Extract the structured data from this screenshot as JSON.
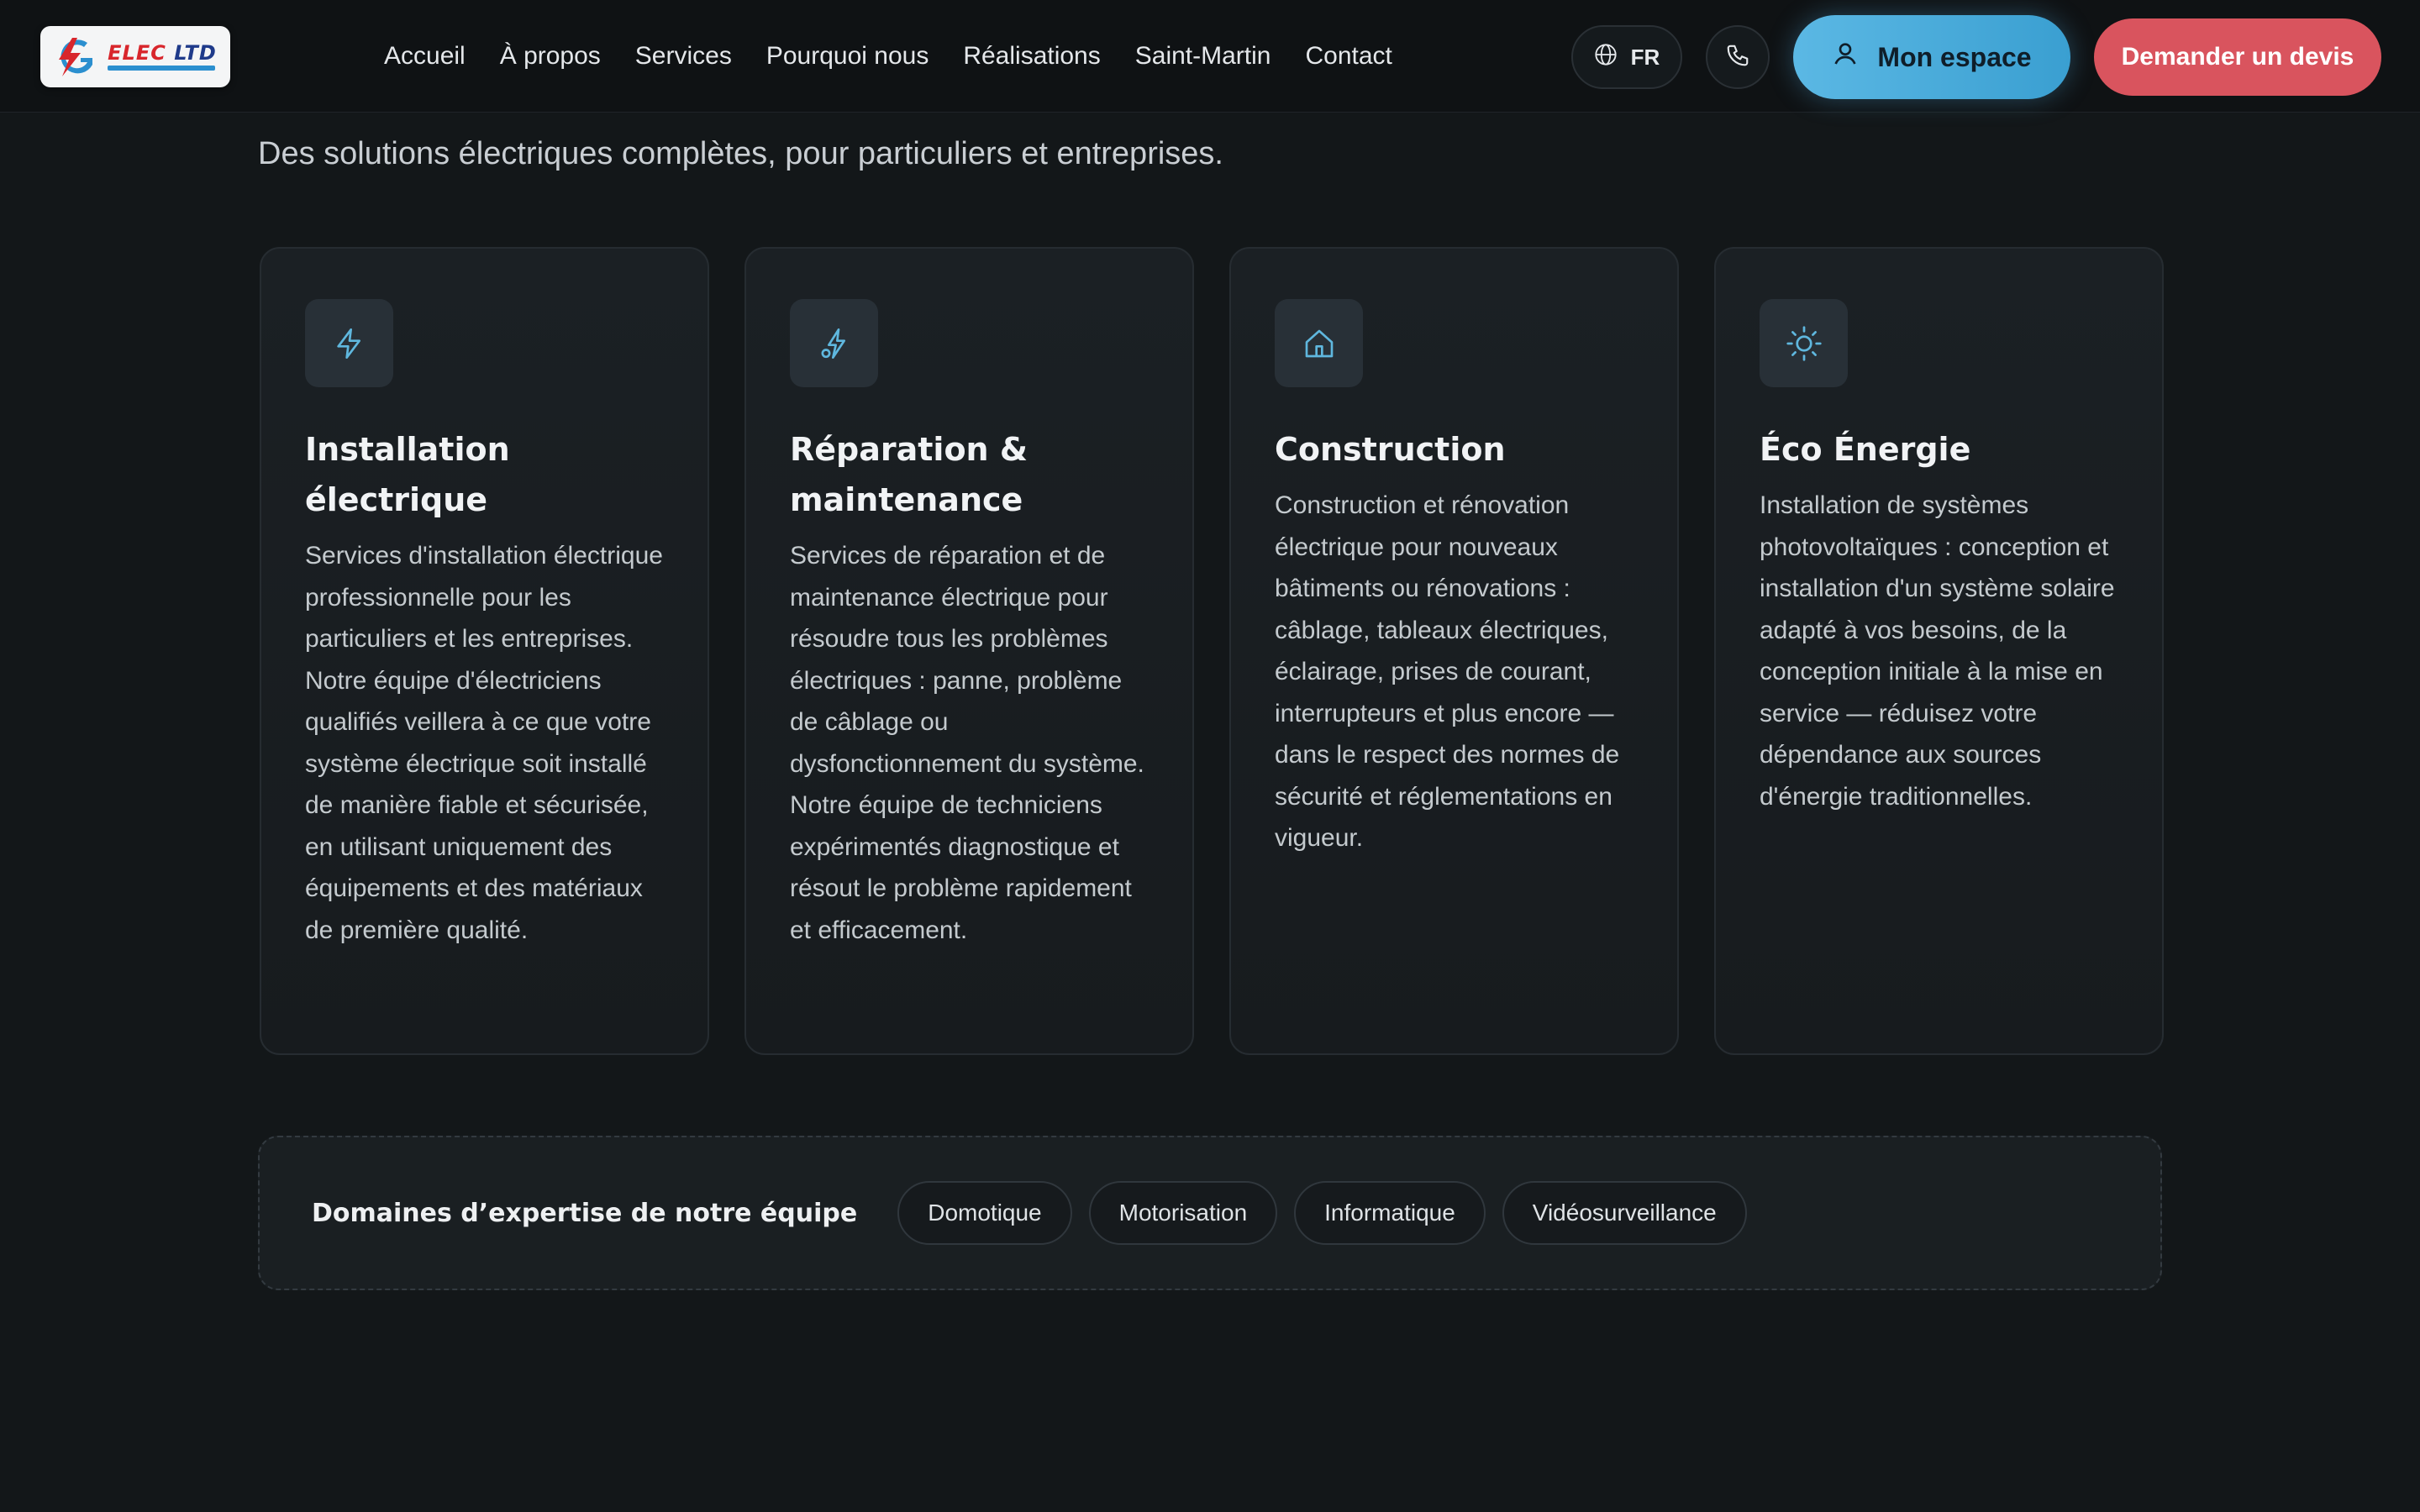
{
  "header": {
    "logo": {
      "word_part1": "ELEC",
      "word_part2": "LTD",
      "brand_red": "#d8262c",
      "brand_blue": "#1e3a8a"
    },
    "nav": [
      {
        "label": "Accueil"
      },
      {
        "label": "À propos"
      },
      {
        "label": "Services"
      },
      {
        "label": "Pourquoi nous"
      },
      {
        "label": "Réalisations"
      },
      {
        "label": "Saint-Martin"
      },
      {
        "label": "Contact"
      }
    ],
    "language": {
      "label": "FR",
      "icon": "globe-icon"
    },
    "phone": {
      "icon": "phone-icon"
    },
    "account_button": {
      "label": "Mon espace",
      "icon": "user-icon",
      "color": "#4aaedb"
    },
    "quote_button": {
      "label": "Demander un devis",
      "color": "#d9545e"
    }
  },
  "main": {
    "subtitle": "Des solutions électriques complètes, pour particuliers et entreprises.",
    "cards": [
      {
        "icon": "lightning-icon",
        "title": "Installation électrique",
        "text": "Services d'installation électrique professionnelle pour les particuliers et les entreprises. Notre équipe d'électriciens qualifiés veillera à ce que votre système électrique soit installé de manière fiable et sécurisée, en utilisant uniquement des équipements et des matériaux de première qualité."
      },
      {
        "icon": "plug-bolt-icon",
        "title": "Réparation & maintenance",
        "text": "Services de réparation et de maintenance électrique pour résoudre tous les problèmes électriques : panne, problème de câblage ou dysfonctionnement du système. Notre équipe de techniciens expérimentés diagnostique et résout le problème rapidement et efficacement."
      },
      {
        "icon": "house-icon",
        "title": "Construction",
        "text": "Construction et rénovation électrique pour nouveaux bâtiments ou rénovations : câblage, tableaux électriques, éclairage, prises de courant, interrupteurs et plus encore — dans le respect des normes de sécurité et réglementations en vigueur."
      },
      {
        "icon": "sun-icon",
        "title": "Éco Énergie",
        "text": "Installation de systèmes photovoltaïques : conception et installation d'un système solaire adapté à vos besoins, de la conception initiale à la mise en service — réduisez votre dépendance aux sources d'énergie traditionnelles."
      }
    ],
    "expertise": {
      "label": "Domaines d’expertise de notre équipe",
      "chips": [
        "Domotique",
        "Motorisation",
        "Informatique",
        "Vidéosurveillance"
      ]
    },
    "accent_color": "#5fb7de"
  }
}
